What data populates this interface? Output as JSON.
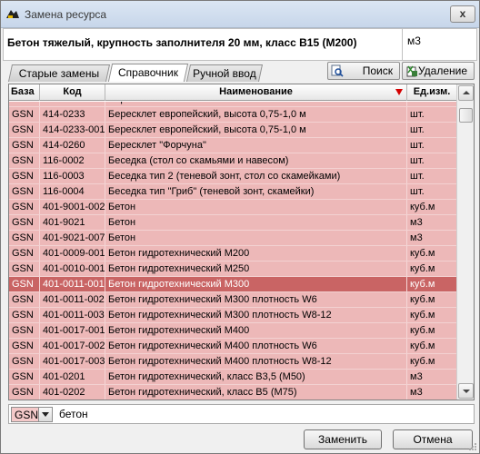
{
  "window": {
    "title": "Замена ресурса",
    "close_label": "x"
  },
  "resource": {
    "name": "Бетон тяжелый, крупность заполнителя 20 мм, класс В15 (М200)",
    "unit": "м3"
  },
  "tabs": [
    {
      "label": "Старые замены",
      "active": false
    },
    {
      "label": "Справочник",
      "active": true
    },
    {
      "label": "Ручной ввод",
      "active": false
    }
  ],
  "toolbar": {
    "search_label": "Поиск",
    "delete_label": "Удаление"
  },
  "table": {
    "columns": [
      "База",
      "Код",
      "Наименование",
      "Ед.изм."
    ],
    "rows": [
      {
        "base": "GSN",
        "code": "414-0242-001",
        "name": "Бересклет",
        "unit": "шт."
      },
      {
        "base": "GSN",
        "code": "414-0233",
        "name": "Бересклет европейский, высота 0,75-1,0 м",
        "unit": "шт."
      },
      {
        "base": "GSN",
        "code": "414-0233-001",
        "name": "Бересклет европейский, высота 0,75-1,0 м",
        "unit": "шт."
      },
      {
        "base": "GSN",
        "code": "414-0260",
        "name": "Бересклет \"Форчуна\"",
        "unit": "шт."
      },
      {
        "base": "GSN",
        "code": "116-0002",
        "name": "Беседка (стол со скамьями и навесом)",
        "unit": "шт."
      },
      {
        "base": "GSN",
        "code": "116-0003",
        "name": "Беседка тип 2 (теневой зонт, стол со скамейками)",
        "unit": "шт."
      },
      {
        "base": "GSN",
        "code": "116-0004",
        "name": "Беседка тип \"Гриб\" (теневой зонт, скамейки)",
        "unit": "шт."
      },
      {
        "base": "GSN",
        "code": "401-9001-002",
        "name": "Бетон",
        "unit": "куб.м"
      },
      {
        "base": "GSN",
        "code": "401-9021",
        "name": "Бетон",
        "unit": "м3"
      },
      {
        "base": "GSN",
        "code": "401-9021-007",
        "name": "Бетон",
        "unit": "м3"
      },
      {
        "base": "GSN",
        "code": "401-0009-001",
        "name": "Бетон гидротехнический М200",
        "unit": "куб.м"
      },
      {
        "base": "GSN",
        "code": "401-0010-001",
        "name": "Бетон гидротехнический М250",
        "unit": "куб.м"
      },
      {
        "base": "GSN",
        "code": "401-0011-001",
        "name": "Бетон гидротехнический М300",
        "unit": "куб.м",
        "selected": true
      },
      {
        "base": "GSN",
        "code": "401-0011-002",
        "name": "Бетон гидротехнический М300 плотность W6",
        "unit": "куб.м"
      },
      {
        "base": "GSN",
        "code": "401-0011-003",
        "name": "Бетон гидротехнический М300 плотность W8-12",
        "unit": "куб.м"
      },
      {
        "base": "GSN",
        "code": "401-0017-001",
        "name": "Бетон гидротехнический М400",
        "unit": "куб.м"
      },
      {
        "base": "GSN",
        "code": "401-0017-002",
        "name": "Бетон гидротехнический М400 плотность W6",
        "unit": "куб.м"
      },
      {
        "base": "GSN",
        "code": "401-0017-003",
        "name": "Бетон гидротехнический М400 плотность W8-12",
        "unit": "куб.м"
      },
      {
        "base": "GSN",
        "code": "401-0201",
        "name": "Бетон гидротехнический, класс В3,5 (М50)",
        "unit": "м3"
      },
      {
        "base": "GSN",
        "code": "401-0202",
        "name": "Бетон гидротехнический, класс В5 (М75)",
        "unit": "м3"
      }
    ]
  },
  "filter": {
    "base_value": "GSN",
    "search_value": "бетон"
  },
  "buttons": {
    "replace_label": "Заменить",
    "cancel_label": "Отмена"
  },
  "colors": {
    "row_background": "#edb8b8",
    "row_selected": "#c96464",
    "sort_indicator": "#d40000"
  }
}
